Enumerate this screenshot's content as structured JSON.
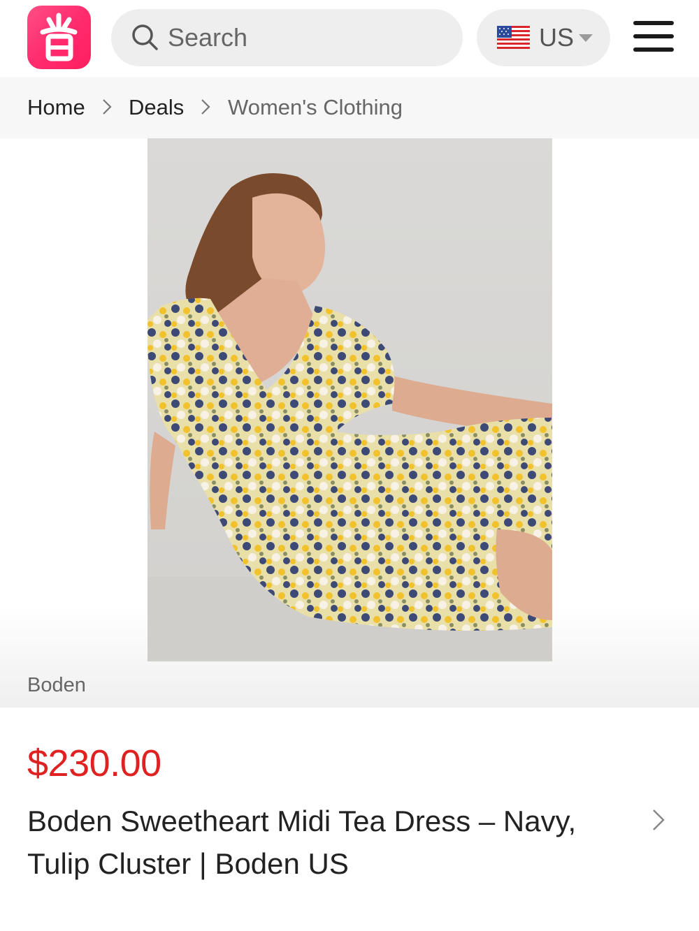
{
  "header": {
    "logo_icon": "app-logo-icon",
    "search_placeholder": "Search",
    "region": {
      "label": "US",
      "flag_icon": "us-flag-icon"
    },
    "menu_icon": "hamburger-menu-icon"
  },
  "breadcrumb": {
    "items": [
      "Home",
      "Deals",
      "Women's Clothing"
    ]
  },
  "product": {
    "brand": "Boden",
    "price": "$230.00",
    "title": "Boden Sweetheart Midi Tea Dress – Navy, Tulip Cluster | Boden US"
  },
  "colors": {
    "accent": "#ff2c6e",
    "price": "#e02121"
  }
}
